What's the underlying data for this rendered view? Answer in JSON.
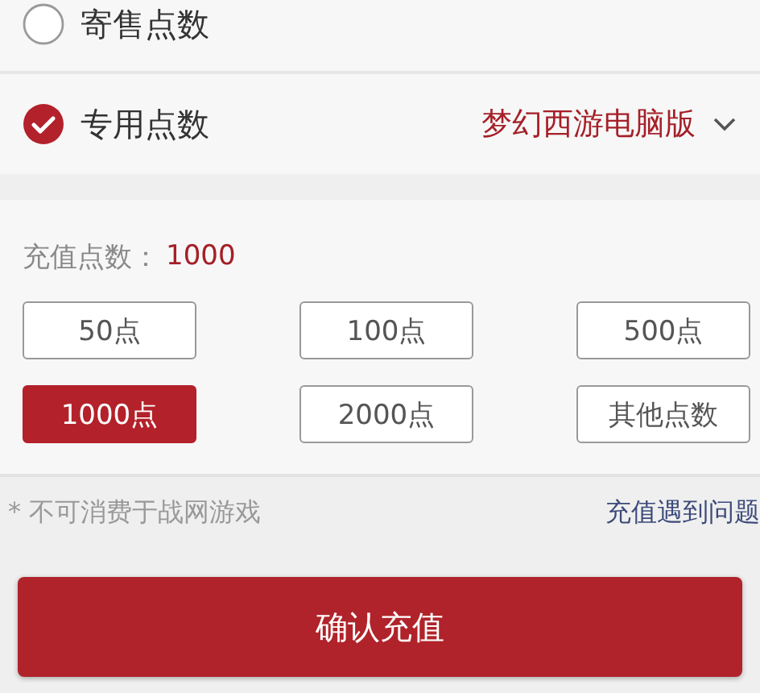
{
  "point_types": [
    {
      "label": "寄售点数",
      "selected": false
    },
    {
      "label": "专用点数",
      "selected": true,
      "game": "梦幻西游电脑版"
    }
  ],
  "recharge": {
    "label": "充值点数：",
    "value": "1000",
    "options": [
      {
        "label": "50点",
        "selected": false
      },
      {
        "label": "100点",
        "selected": false
      },
      {
        "label": "500点",
        "selected": false
      },
      {
        "label": "1000点",
        "selected": true
      },
      {
        "label": "2000点",
        "selected": false
      },
      {
        "label": "其他点数",
        "selected": false
      }
    ]
  },
  "note": "* 不可消费于战网游戏",
  "help_link": "充值遇到问题",
  "confirm_button": "确认充值"
}
